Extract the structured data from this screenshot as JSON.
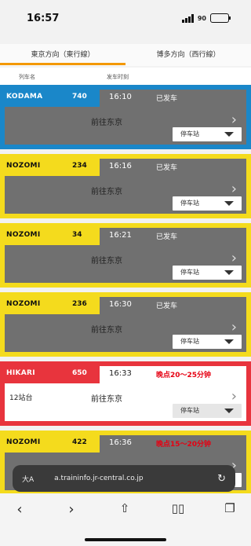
{
  "status": {
    "time": "16:57",
    "battery": "90"
  },
  "tabs": [
    {
      "label": "東京方向（東行線）",
      "active": true
    },
    {
      "label": "博多方向（西行線）",
      "active": false
    }
  ],
  "columns": {
    "train": "列车名",
    "dep": "发车时刻"
  },
  "trains": [
    {
      "name": "KODAMA",
      "num": "740",
      "time": "16:10",
      "status": "已发车",
      "dest": "前往东京",
      "stops": "",
      "style": "blue"
    },
    {
      "name": "NOZOMI",
      "num": "234",
      "time": "16:16",
      "status": "已发车",
      "dest": "前往东京",
      "stops": "",
      "style": "yellow"
    },
    {
      "name": "NOZOMI",
      "num": "34",
      "time": "16:21",
      "status": "已发车",
      "dest": "前往东京",
      "stops": "",
      "style": "yellow"
    },
    {
      "name": "NOZOMI",
      "num": "236",
      "time": "16:30",
      "status": "已发车",
      "dest": "前往东京",
      "stops": "",
      "style": "yellow"
    },
    {
      "name": "HIKARI",
      "num": "650",
      "time": "16:33",
      "status": "晚点20～25分钟",
      "dest": "前往东京",
      "stops": "12站台",
      "style": "red"
    },
    {
      "name": "NOZOMI",
      "num": "422",
      "time": "16:36",
      "status": "晚点15～20分钟",
      "dest": "",
      "stops": "",
      "style": "yellow"
    }
  ],
  "stop_button_label": "停车站",
  "browser": {
    "aa": "大A",
    "url": "a.traininfo.jr-central.co.jp"
  },
  "icons": {
    "back": "chevron-left-icon",
    "forward": "chevron-right-icon",
    "share": "share-icon",
    "bookmarks": "book-icon",
    "tabs": "tabs-icon"
  },
  "colors": {
    "blue": "#1a87c9",
    "yellow": "#f4db1d",
    "red": "#e8343d",
    "tab_accent": "#f39800"
  }
}
